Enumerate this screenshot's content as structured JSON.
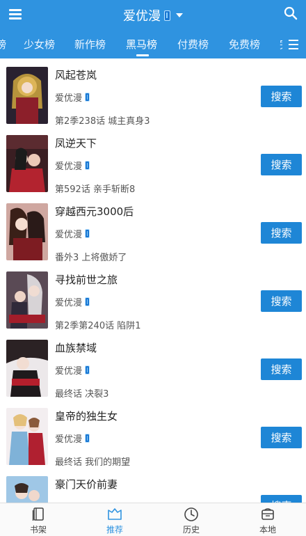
{
  "header": {
    "title": "爱优漫",
    "menu_icon": "menu-icon",
    "search_icon": "search-icon",
    "dropdown_icon": "caret-down-icon",
    "accent_color": "#2f93e0"
  },
  "tabs": [
    {
      "label": "榜"
    },
    {
      "label": "少女榜"
    },
    {
      "label": "新作榜"
    },
    {
      "label": "黑马榜",
      "active": true
    },
    {
      "label": "付费榜"
    },
    {
      "label": "免费榜"
    },
    {
      "label": "完"
    }
  ],
  "list": {
    "search_label": "搜索",
    "items": [
      {
        "title": "风起苍岚",
        "source": "爱优漫",
        "chapter": "第2季238话 城主真身3"
      },
      {
        "title": "凤逆天下",
        "source": "爱优漫",
        "chapter": "第592话 亲手斩断8"
      },
      {
        "title": "穿越西元3000后",
        "source": "爱优漫",
        "chapter": "番外3 上将傲娇了"
      },
      {
        "title": "寻找前世之旅",
        "source": "爱优漫",
        "chapter": "第2季第240话 陷阱1"
      },
      {
        "title": "血族禁域",
        "source": "爱优漫",
        "chapter": "最终话 决裂3"
      },
      {
        "title": "皇帝的独生女",
        "source": "爱优漫",
        "chapter": "最终话 我们的期望"
      },
      {
        "title": "豪门天价前妻",
        "source": "",
        "chapter": ""
      }
    ]
  },
  "bottom_nav": [
    {
      "label": "书架",
      "icon": "bookshelf-icon"
    },
    {
      "label": "推荐",
      "icon": "recommend-icon",
      "active": true
    },
    {
      "label": "历史",
      "icon": "clock-icon"
    },
    {
      "label": "本地",
      "icon": "local-storage-icon"
    }
  ]
}
